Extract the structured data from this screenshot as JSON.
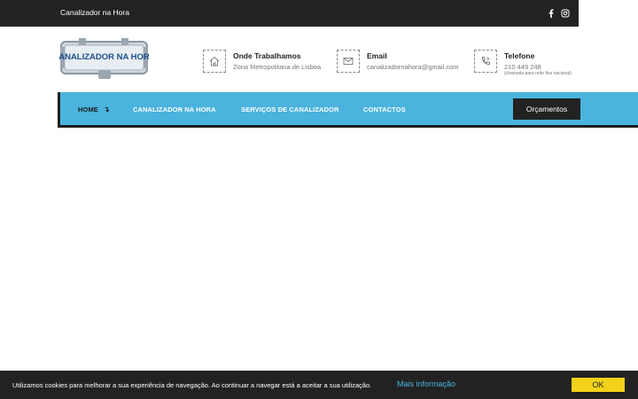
{
  "topbar": {
    "site_name": "Canalizador na Hora",
    "social": [
      "facebook-icon",
      "instagram-icon"
    ]
  },
  "logo": {
    "text": "CANALIZADOR NA HORA"
  },
  "header_info": {
    "where": {
      "title": "Onde Trabalhamos",
      "value": "Zona Metropolitana de Lisboa",
      "icon": "home-icon"
    },
    "email": {
      "title": "Email",
      "value": "canalizadornahora@gmail.com",
      "icon": "envelope-icon"
    },
    "phone": {
      "title": "Telefone",
      "value": "210 449 248",
      "note": "(chamada para rede fixa nacional)",
      "icon": "phone-icon"
    }
  },
  "nav": {
    "home": "HOME",
    "home_arrow": "↴",
    "items": [
      "CANALIZADOR NA HORA",
      "SERVIÇOS DE CANALIZADOR",
      "CONTACTOS"
    ],
    "cta": "Orçamentos"
  },
  "cookie": {
    "message": "Utilizamos cookies para melhorar a sua experiência de navegação. Ao continuar a navegar está a aceitar a sua utilização.",
    "more_link": "Mais informação",
    "ok": "OK"
  },
  "colors": {
    "dark": "#222222",
    "nav_blue": "#4ab3de",
    "ok_yellow": "#f2d21a"
  }
}
